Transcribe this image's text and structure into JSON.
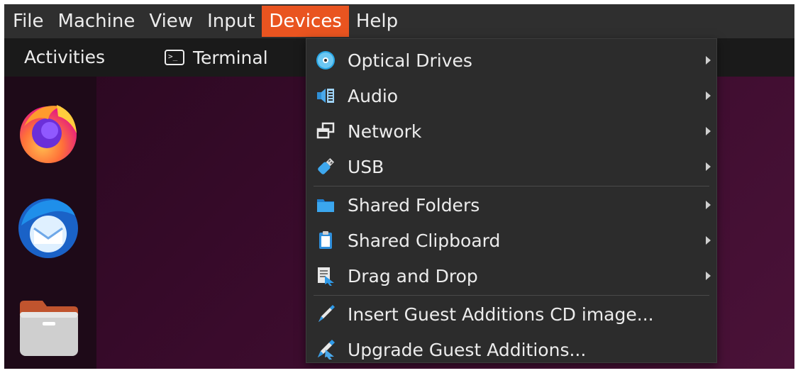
{
  "menubar": {
    "items": [
      "File",
      "Machine",
      "View",
      "Input",
      "Devices",
      "Help"
    ],
    "active": "Devices",
    "active_color": "#e95420"
  },
  "topbar": {
    "activities": "Activities",
    "app_name": "Terminal",
    "app_icon": "terminal-icon"
  },
  "dock": {
    "apps": [
      "firefox-icon",
      "thunderbird-icon",
      "files-icon"
    ]
  },
  "devices_menu": {
    "items": [
      {
        "label": "Optical Drives",
        "icon": "optical-drive-icon",
        "submenu": true
      },
      {
        "label": "Audio",
        "icon": "audio-icon",
        "submenu": true
      },
      {
        "label": "Network",
        "icon": "network-icon",
        "submenu": true
      },
      {
        "label": "USB",
        "icon": "usb-icon",
        "submenu": true
      },
      {
        "label": "Shared Folders",
        "icon": "shared-folders-icon",
        "submenu": true
      },
      {
        "label": "Shared Clipboard",
        "icon": "shared-clipboard-icon",
        "submenu": true
      },
      {
        "label": "Drag and Drop",
        "icon": "drag-and-drop-icon",
        "submenu": true
      },
      {
        "label": "Insert Guest Additions CD image...",
        "icon": "insert-cd-icon",
        "submenu": false
      },
      {
        "label": "Upgrade Guest Additions...",
        "icon": "upgrade-icon",
        "submenu": false
      }
    ]
  }
}
